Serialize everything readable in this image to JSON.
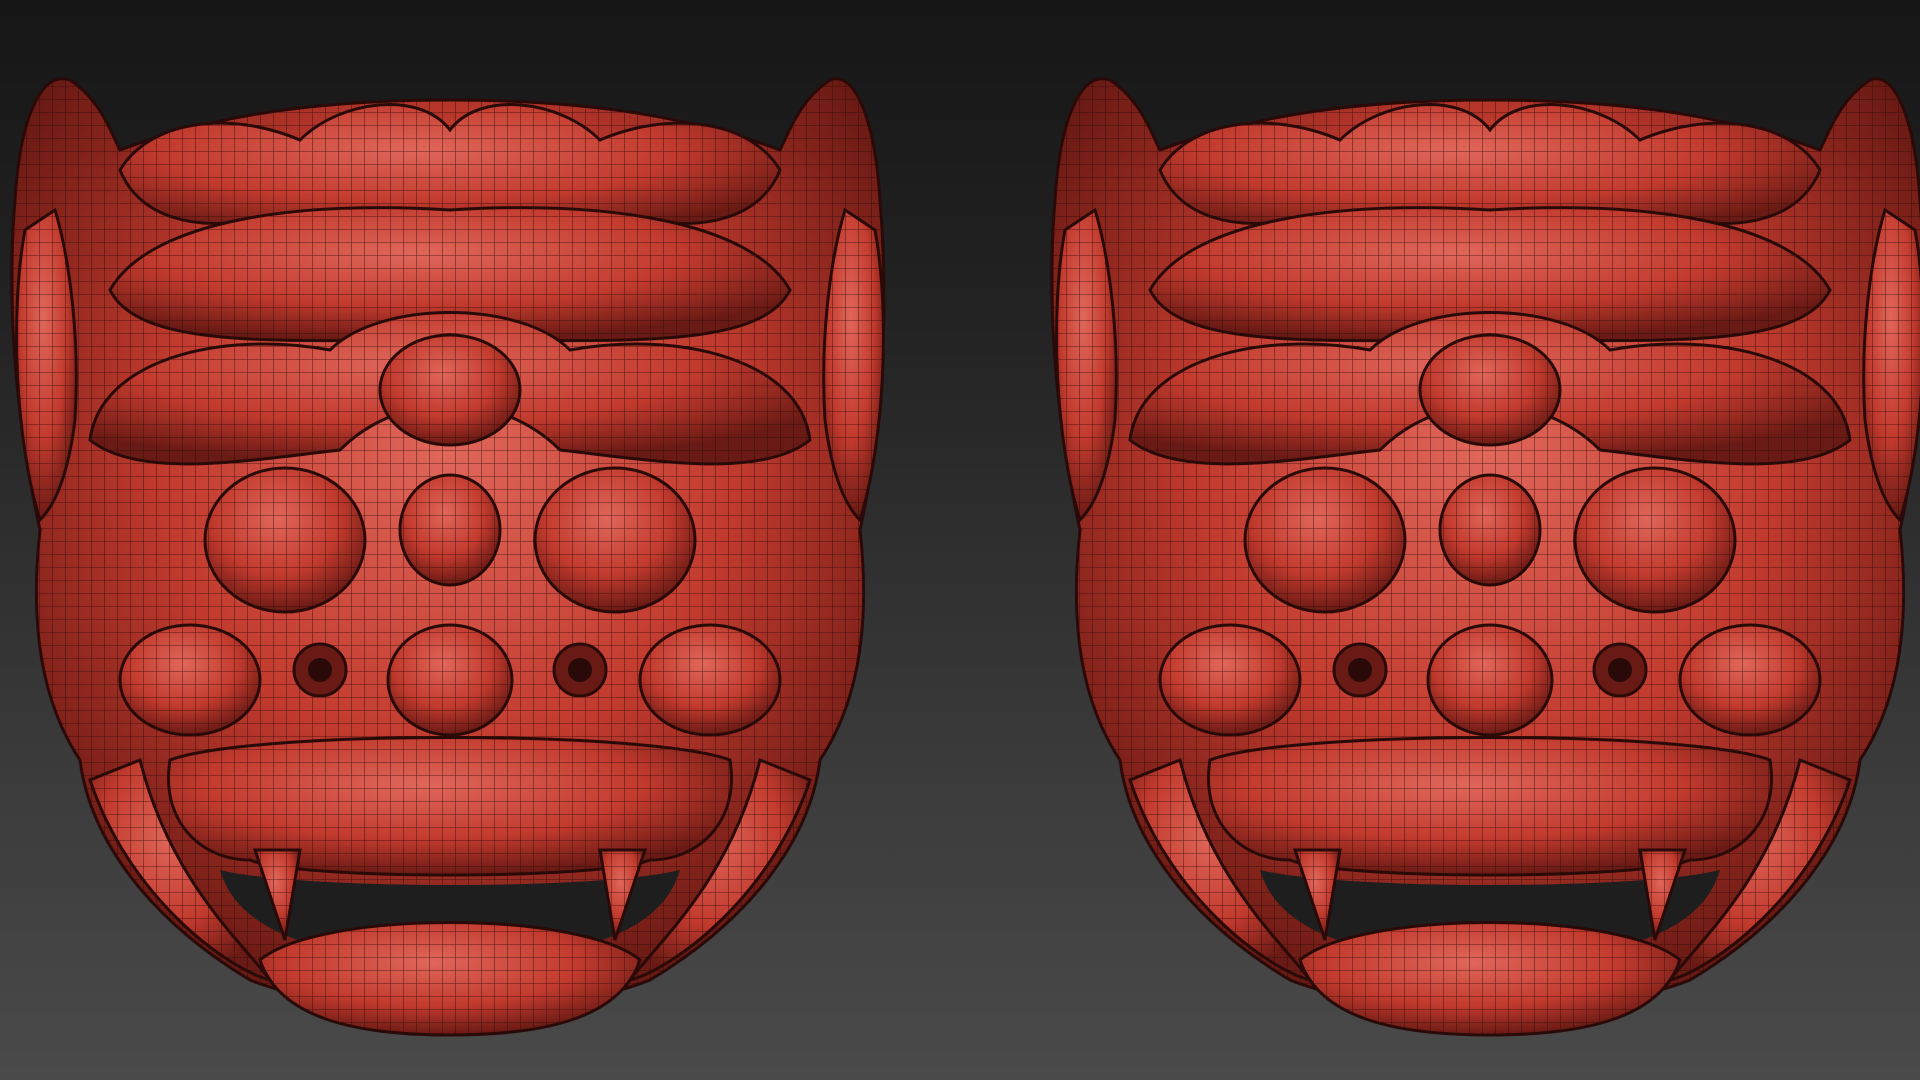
{
  "viewport": {
    "background_top": "#161616",
    "background_bottom": "#4a4a4a"
  },
  "models": [
    {
      "id": "mask-left",
      "name": "demon-mask-wireframe-left",
      "material_color": "#c23a2e"
    },
    {
      "id": "mask-right",
      "name": "demon-mask-wireframe-right",
      "material_color": "#c23a2e"
    }
  ],
  "colors": {
    "material_base": "#c23a2e",
    "material_highlight": "#e0675a",
    "material_shadow": "#6a1a14",
    "wire": "#2a0a08"
  }
}
